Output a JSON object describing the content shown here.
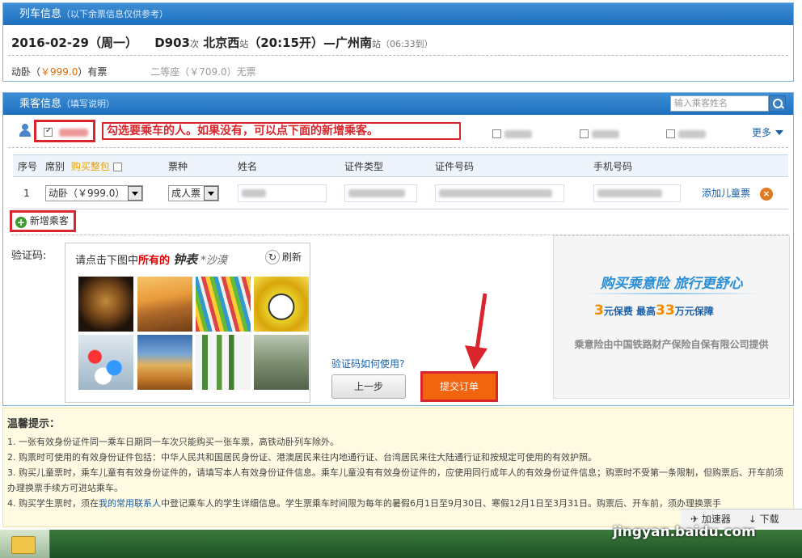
{
  "train_panel": {
    "title": "列车信息",
    "note": "（以下余票信息仅供参考）",
    "date": "2016-02-29（周一）",
    "train_no": "D903",
    "train_suffix": "次",
    "from_station": "北京西",
    "station_suffix": "站",
    "depart": "（20:15开）",
    "dash": "—",
    "to_station": "广州南",
    "arrive": "（06:33到）",
    "seat1_name": "动卧（",
    "seat1_price": "￥999.0",
    "seat1_status": "）有票",
    "seat2": "二等座（￥709.0）无票"
  },
  "passenger_panel": {
    "title": "乘客信息",
    "note": "（填写说明）",
    "search_placeholder": "输入乘客姓名",
    "instruction": "勾选要乘车的人。如果没有，可以点下面的新增乘客。",
    "more": "更多",
    "headers": {
      "seq": "序号",
      "seat": "席别",
      "buy_all": "购买整包",
      "ticket_type": "票种",
      "name": "姓名",
      "id_type": "证件类型",
      "id_no": "证件号码",
      "phone": "手机号码"
    },
    "row": {
      "seq": "1",
      "seat": "动卧（￥999.0）",
      "ticket_type": "成人票",
      "add_child": "添加儿童票",
      "remove": "×"
    },
    "add_passenger": "新增乘客",
    "captcha_label": "验证码:",
    "captcha": {
      "prefix": "请点击下图中",
      "all": "所有的",
      "word1": "钟表",
      "word2": "*沙漠",
      "refresh": "刷新"
    },
    "verify_help": "验证码如何使用?",
    "prev_btn": "上一步",
    "submit_btn": "提交订单",
    "insurance": {
      "slogan": "购买乘意险  旅行更舒心",
      "price_num": "3",
      "price_text1": "元保费  最高",
      "cover_num": "33",
      "price_text2": "万元保障",
      "provider": "乘意险由中国铁路财产保险自保有限公司提供"
    }
  },
  "tips": {
    "title": "温馨提示：",
    "items": [
      "1. 一张有效身份证件同一乘车日期同一车次只能购买一张车票，高铁动卧列车除外。",
      "2. 购票时可使用的有效身份证件包括：中华人民共和国居民身份证、港澳居民来往内地通行证、台湾居民来往大陆通行证和按规定可使用的有效护照。",
      "3. 购买儿童票时，乘车儿童有有效身份证件的，请填写本人有效身份证件信息。乘车儿童没有有效身份证件的，应使用同行成年人的有效身份证件信息；购票时不受第一条限制，但购票后、开车前须办理换票手续方可进站乘车。"
    ],
    "item4_a": "4. 购买学生票时，须在",
    "item4_link": "我的常用联系人",
    "item4_b": "中登记乘车人的学生详细信息。学生票乘车时间限为每年的暑假6月1日至9月30日、寒假12月1日至3月31日。购票后、开车前，须办理换票手"
  },
  "browser": {
    "accelerator": "加速器",
    "download": "下载",
    "watermark": "jingyan.baidu.com"
  }
}
